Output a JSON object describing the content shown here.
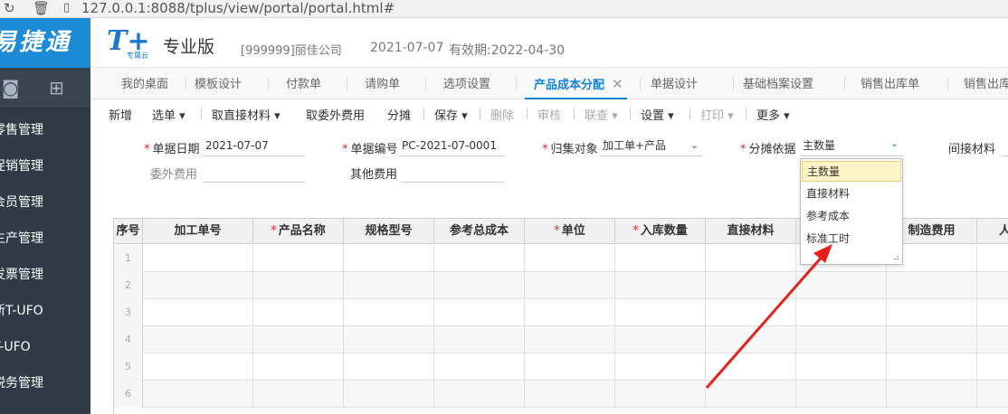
{
  "browser": {
    "url": "127.0.0.1:8088/tplus/view/portal/portal.html#"
  },
  "sidebar": {
    "brand": "易捷通",
    "items": [
      {
        "label": "零售管理"
      },
      {
        "label": "促销管理"
      },
      {
        "label": "会员管理"
      },
      {
        "label": "生产管理"
      },
      {
        "label": "发票管理"
      },
      {
        "label": "新T-UFO"
      },
      {
        "label": "T-UFO"
      },
      {
        "label": "税务管理"
      }
    ]
  },
  "header": {
    "logo_mark": "T+",
    "logo_sub": "专属云",
    "edition": "专业版",
    "company": "[999999]丽佳公司",
    "date": "2021-07-07",
    "valid": "有效期:2022-04-30"
  },
  "tabs": [
    {
      "label": "我的桌面"
    },
    {
      "label": "模板设计"
    },
    {
      "label": "付款单"
    },
    {
      "label": "请购单"
    },
    {
      "label": "选项设置"
    },
    {
      "label": "产品成本分配"
    },
    {
      "label": "单据设计"
    },
    {
      "label": "基础档案设置"
    },
    {
      "label": "销售出库单"
    },
    {
      "label": "销售出库"
    }
  ],
  "toolbar": {
    "new": "新增",
    "select": "选单",
    "fetch_direct": "取直接材料",
    "fetch_outsource": "取委外费用",
    "allocate": "分摊",
    "save": "保存",
    "delete": "删除",
    "audit": "审核",
    "link": "联查",
    "settings": "设置",
    "print": "打印",
    "more": "更多"
  },
  "form": {
    "doc_date_label": "单据日期",
    "doc_date_value": "2021-07-07",
    "doc_no_label": "单据编号",
    "doc_no_value": "PC-2021-07-0001",
    "collect_label": "归集对象",
    "collect_value": "加工单+产品",
    "basis_label": "分摊依据",
    "basis_value": "主数量",
    "indirect_label": "间接材料",
    "outsource_label": "委外费用",
    "other_label": "其他费用"
  },
  "dropdown": {
    "options": [
      {
        "label": "主数量"
      },
      {
        "label": "直接材料"
      },
      {
        "label": "参考成本"
      },
      {
        "label": "标准工时"
      }
    ]
  },
  "grid": {
    "headers": [
      "序号",
      "加工单号",
      "产品名称",
      "规格型号",
      "参考总成本",
      "单位",
      "入库数量",
      "直接材料",
      "",
      "制造费用",
      "人"
    ],
    "rows": [
      "1",
      "2",
      "3",
      "4",
      "5",
      "6"
    ]
  },
  "colors": {
    "accent": "#1a82d8",
    "sidebar": "#313a46",
    "arrow": "#e8201c"
  }
}
